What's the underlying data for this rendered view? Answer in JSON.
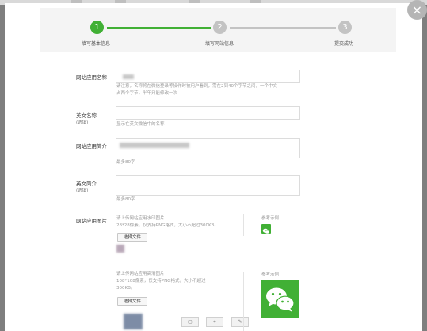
{
  "colors": {
    "accent": "#41b035",
    "inactive": "#c3c3c3",
    "wechat": "#41b035"
  },
  "dialog": {
    "close_label": "×"
  },
  "steps": [
    {
      "number": "1",
      "label": "填写基本信息",
      "active": true
    },
    {
      "number": "2",
      "label": "填写网站信息",
      "active": false
    },
    {
      "number": "3",
      "label": "提交成功",
      "active": false
    }
  ],
  "form": {
    "app_name": {
      "label": "网站应用名称",
      "hint_line1": "请注意，名称将在微信登录等操作时被用户看到，需在2到40个字节之间，一个中文",
      "hint_line2": "占两个字节，半年只能修改一次"
    },
    "english_name": {
      "label": "英文名称",
      "optional": "(选填)",
      "hint": "显示在英文微信中的名称"
    },
    "app_desc": {
      "label": "网站应用简介",
      "hint": "最多80字"
    },
    "english_desc": {
      "label": "英文简介",
      "optional": "(选填)",
      "hint": "最多80字"
    },
    "app_image": {
      "label": "网站应用图片",
      "small": {
        "hint_line1": "请上传网站应用水印图片",
        "hint_line2": "28*28像素，仅支持PNG格式，大小不超过300KB。",
        "button": "选择文件",
        "example_label": "参考示例"
      },
      "large": {
        "hint_line1": "请上传网站应用高清图片",
        "hint_line2": "108*108像素，仅支持PNG格式，大小不超过",
        "hint_line3": "300KB。",
        "button": "选择文件",
        "example_label": "参考示例"
      }
    }
  },
  "icons": [
    "close-icon",
    "wechat-logo-icon",
    "crop-icon",
    "select-icon",
    "edit-icon"
  ]
}
